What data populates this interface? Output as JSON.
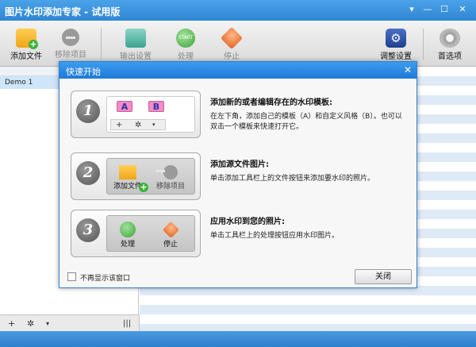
{
  "window": {
    "title": "图片水印添加专家 - 试用版",
    "help_glyph": "▾",
    "minimize_glyph": "—",
    "maximize_glyph": "☐",
    "close_glyph": "✕"
  },
  "toolbar": {
    "add_files": "添加文件",
    "remove_item": "移除项目",
    "output_settings": "输出设置",
    "process": "处理",
    "stop": "停止",
    "adjust_settings": "调整设置",
    "preferences": "首选项",
    "start_icon_text": "START"
  },
  "sidebar": {
    "items": [
      "Demo 1"
    ],
    "add_glyph": "+",
    "gear_glyph": "✲",
    "dropdown_glyph": "▾",
    "columns_glyph": "|||"
  },
  "dialog": {
    "title": "快速开始",
    "close_glyph": "✕",
    "steps": [
      {
        "number": "1",
        "heading": "添加新的或者编辑存在的水印模板:",
        "text": "在左下角，添加自己的模板（A）和自定义风格（B）。也可以双击一个模板来快速打开它。",
        "tag_a": "A",
        "tag_b": "B"
      },
      {
        "number": "2",
        "heading": "添加源文件图片:",
        "text": "单击添加工具栏上的文件按钮来添加要水印的照片。",
        "btn1": "添加文件",
        "btn2": "移除项目"
      },
      {
        "number": "3",
        "heading": "应用水印到您的照片:",
        "text": "单击工具栏上的处理按钮应用水印图片。",
        "btn1": "处理",
        "btn2": "停止"
      }
    ],
    "dont_show": "不再显示该窗口",
    "close_button": "关闭"
  }
}
